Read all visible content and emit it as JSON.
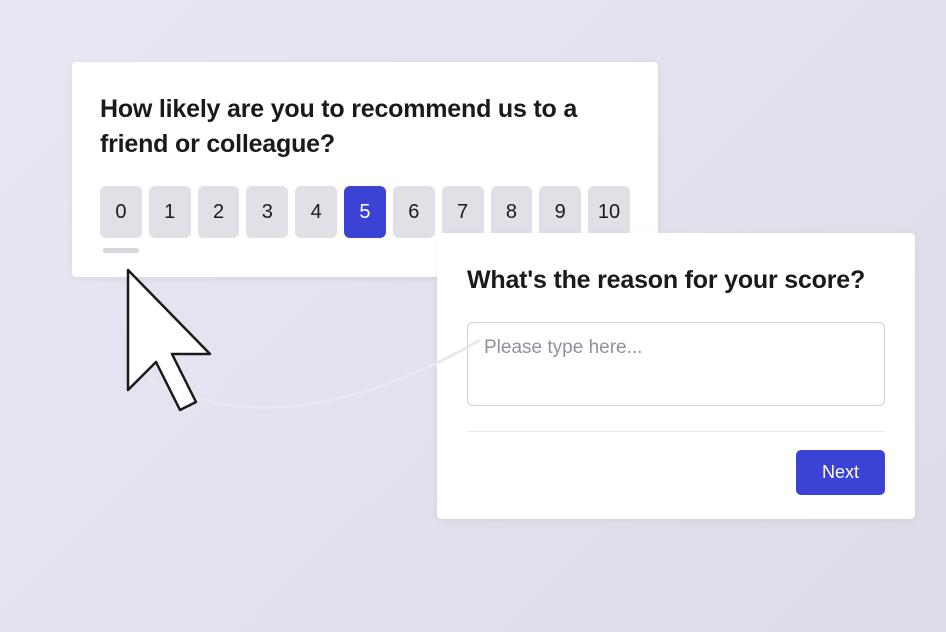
{
  "nps": {
    "question": "How likely are you to recommend us to a friend or colleague?",
    "ratings": [
      "0",
      "1",
      "2",
      "3",
      "4",
      "5",
      "6",
      "7",
      "8",
      "9",
      "10"
    ],
    "selected_index": 5
  },
  "reason": {
    "question": "What's the reason for your score?",
    "placeholder": "Please type here...",
    "next_label": "Next"
  },
  "colors": {
    "accent": "#3b42d4",
    "rating_bg": "#e0e0e7"
  }
}
